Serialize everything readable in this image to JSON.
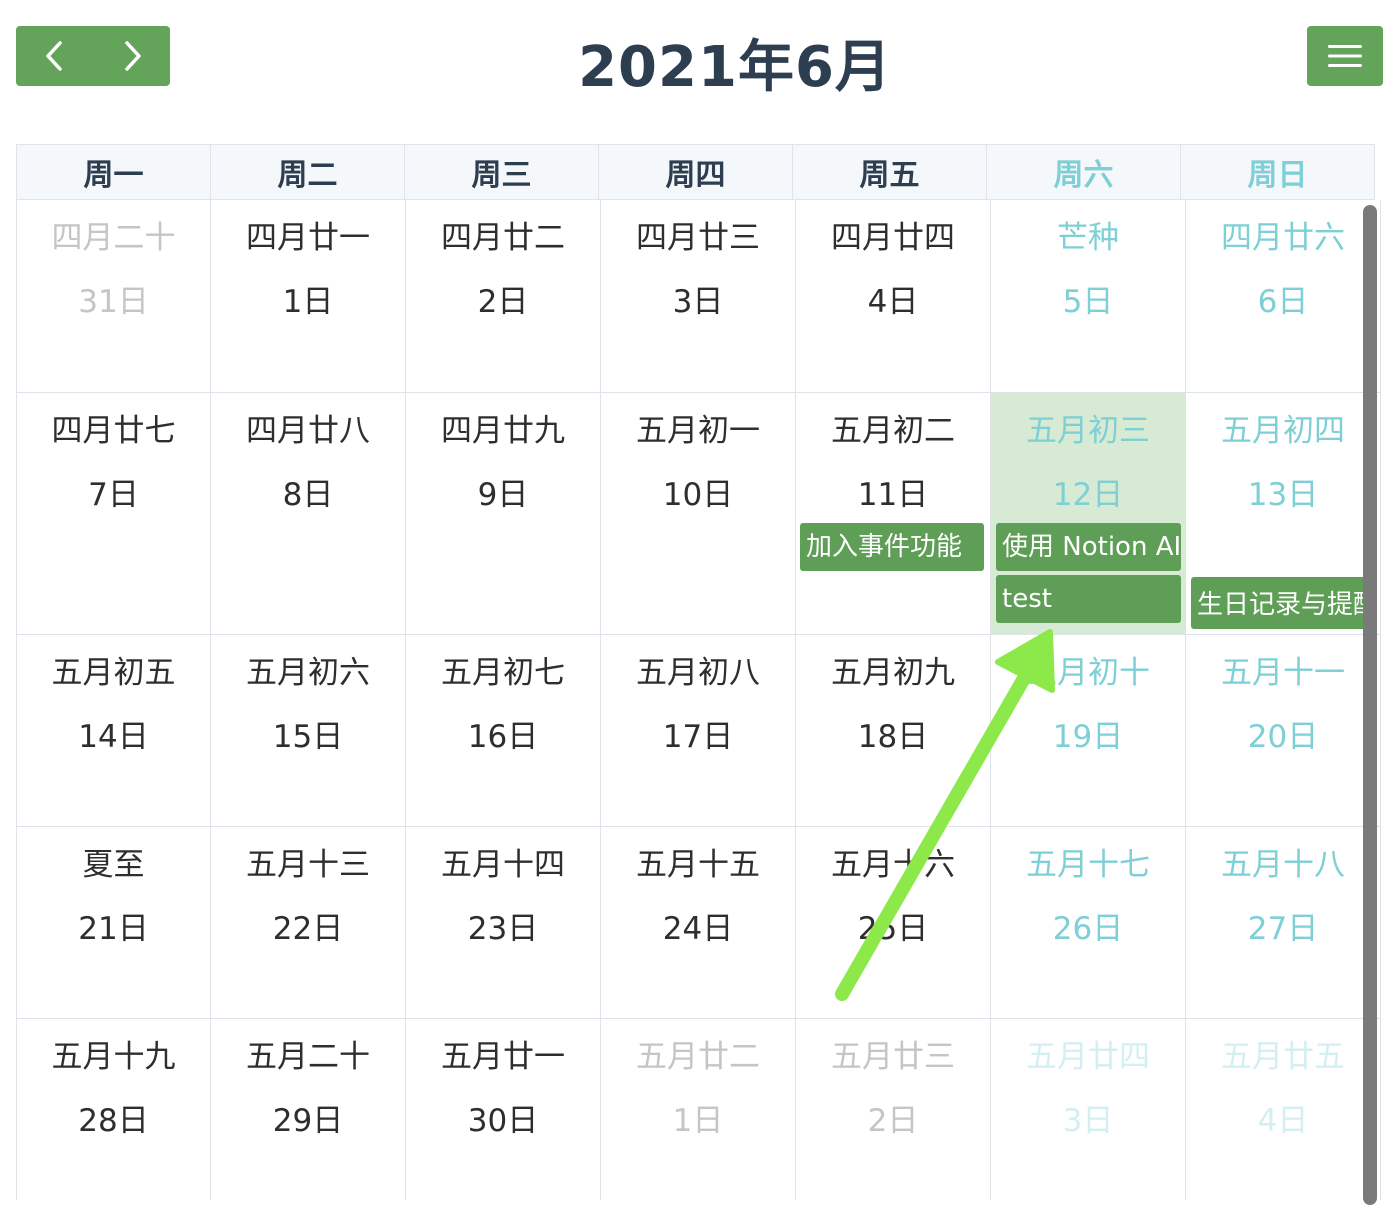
{
  "header": {
    "title": "2021年6月",
    "prev_icon": "chevron-left-icon",
    "next_icon": "chevron-right-icon",
    "menu_icon": "hamburger-menu-icon"
  },
  "weekdays": [
    "周一",
    "周二",
    "周三",
    "周四",
    "周五",
    "周六",
    "周日"
  ],
  "weeks": [
    [
      {
        "lunar": "四月二十",
        "day": "31日",
        "other": true
      },
      {
        "lunar": "四月廿一",
        "day": "1日"
      },
      {
        "lunar": "四月廿二",
        "day": "2日"
      },
      {
        "lunar": "四月廿三",
        "day": "3日"
      },
      {
        "lunar": "四月廿四",
        "day": "4日"
      },
      {
        "lunar": "芒种",
        "day": "5日"
      },
      {
        "lunar": "四月廿六",
        "day": "6日"
      }
    ],
    [
      {
        "lunar": "四月廿七",
        "day": "7日"
      },
      {
        "lunar": "四月廿八",
        "day": "8日"
      },
      {
        "lunar": "四月廿九",
        "day": "9日"
      },
      {
        "lunar": "五月初一",
        "day": "10日"
      },
      {
        "lunar": "五月初二",
        "day": "11日"
      },
      {
        "lunar": "五月初三",
        "day": "12日",
        "today": true
      },
      {
        "lunar": "五月初四",
        "day": "13日"
      }
    ],
    [
      {
        "lunar": "五月初五",
        "day": "14日"
      },
      {
        "lunar": "五月初六",
        "day": "15日"
      },
      {
        "lunar": "五月初七",
        "day": "16日"
      },
      {
        "lunar": "五月初八",
        "day": "17日"
      },
      {
        "lunar": "五月初九",
        "day": "18日"
      },
      {
        "lunar": "五月初十",
        "day": "19日"
      },
      {
        "lunar": "五月十一",
        "day": "20日"
      }
    ],
    [
      {
        "lunar": "夏至",
        "day": "21日"
      },
      {
        "lunar": "五月十三",
        "day": "22日"
      },
      {
        "lunar": "五月十四",
        "day": "23日"
      },
      {
        "lunar": "五月十五",
        "day": "24日"
      },
      {
        "lunar": "五月十六",
        "day": "25日"
      },
      {
        "lunar": "五月十七",
        "day": "26日"
      },
      {
        "lunar": "五月十八",
        "day": "27日"
      }
    ],
    [
      {
        "lunar": "五月十九",
        "day": "28日"
      },
      {
        "lunar": "五月二十",
        "day": "29日"
      },
      {
        "lunar": "五月廿一",
        "day": "30日"
      },
      {
        "lunar": "五月廿二",
        "day": "1日",
        "other": true
      },
      {
        "lunar": "五月廿三",
        "day": "2日",
        "other": true
      },
      {
        "lunar": "五月廿四",
        "day": "3日",
        "other": true
      },
      {
        "lunar": "五月廿五",
        "day": "4日",
        "other": true
      }
    ]
  ],
  "events": {
    "e1": "加入事件功能",
    "e2": "使用 Notion AI",
    "e3": "test",
    "e4": "生日记录与提醒"
  },
  "colors": {
    "accent_green": "#63a45a",
    "today_bg": "#d7ead3",
    "weekend_text": "#7ecfd6",
    "annotation_arrow": "#8de84a"
  }
}
